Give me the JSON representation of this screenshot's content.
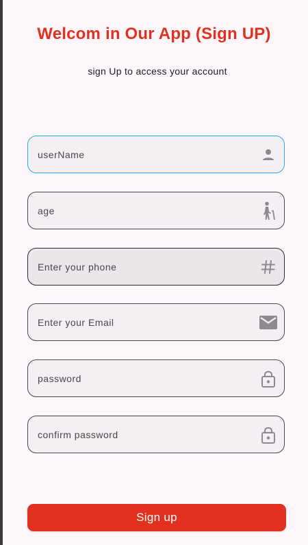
{
  "header": {
    "title": "Welcom in Our App (Sign UP)",
    "subtitle": "sign Up to access your account"
  },
  "form": {
    "fields": [
      {
        "placeholder": "userName",
        "value": "",
        "icon": "person-icon"
      },
      {
        "placeholder": "age",
        "value": "",
        "icon": "elderly-walker-icon"
      },
      {
        "placeholder": "Enter your phone",
        "value": "",
        "icon": "hashtag-icon"
      },
      {
        "placeholder": "Enter your Email",
        "value": "",
        "icon": "email-icon"
      },
      {
        "placeholder": "password",
        "value": "",
        "icon": "lock-icon"
      },
      {
        "placeholder": "confirm password",
        "value": "",
        "icon": "lock-icon"
      }
    ],
    "submit_label": "Sign up"
  },
  "colors": {
    "accent": "#e1311f",
    "focus_border": "#2aa6e6",
    "background": "#fdf7fc",
    "field_fill": "#f4eff3"
  }
}
